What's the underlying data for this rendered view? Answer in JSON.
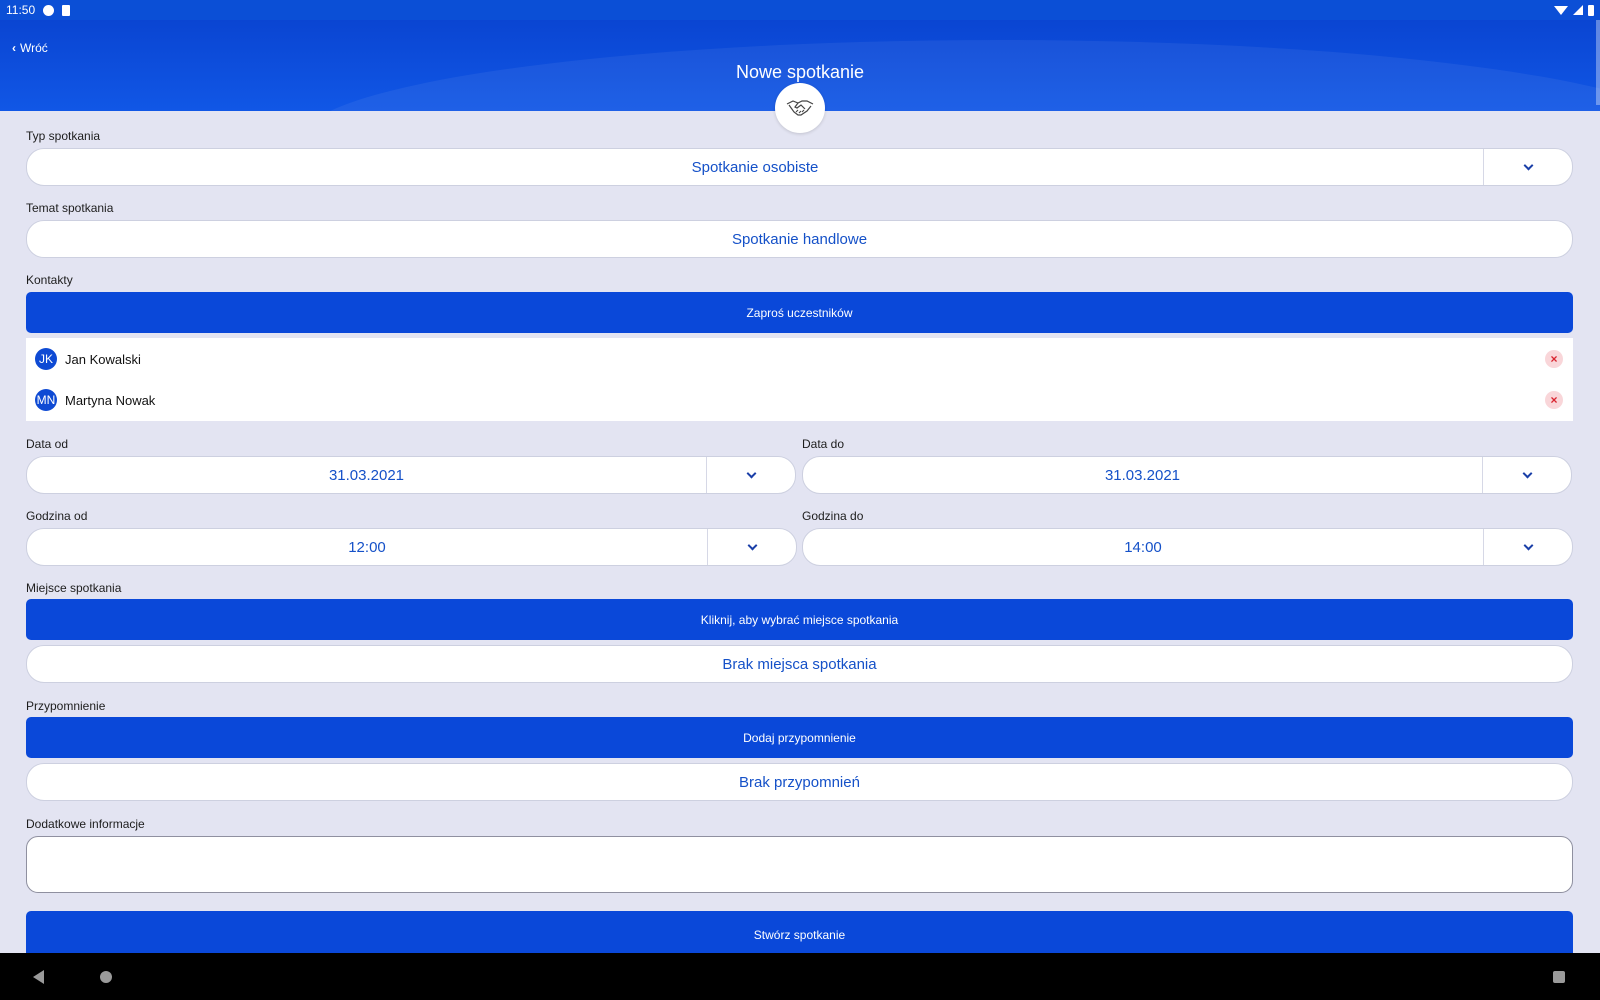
{
  "status_bar": {
    "time": "11:50"
  },
  "header": {
    "back_label": "Wróć",
    "title": "Nowe spotkanie",
    "badge_icon": "handshake-icon"
  },
  "form": {
    "meeting_type": {
      "label": "Typ spotkania",
      "value": "Spotkanie osobiste"
    },
    "meeting_topic": {
      "label": "Temat spotkania",
      "value": "Spotkanie handlowe"
    },
    "contacts": {
      "label": "Kontakty",
      "invite_button": "Zaproś uczestników",
      "items": [
        {
          "initials": "JK",
          "name": "Jan Kowalski"
        },
        {
          "initials": "MN",
          "name": "Martyna Nowak"
        }
      ]
    },
    "date_from": {
      "label": "Data od",
      "value": "31.03.2021"
    },
    "date_to": {
      "label": "Data do",
      "value": "31.03.2021"
    },
    "time_from": {
      "label": "Godzina od",
      "value": "12:00"
    },
    "time_to": {
      "label": "Godzina do",
      "value": "14:00"
    },
    "location": {
      "label": "Miejsce spotkania",
      "button": "Kliknij, aby wybrać miejsce spotkania",
      "value": "Brak miejsca spotkania"
    },
    "reminder": {
      "label": "Przypomnienie",
      "button": "Dodaj przypomnienie",
      "value": "Brak przypomnień"
    },
    "additional_info": {
      "label": "Dodatkowe informacje",
      "value": ""
    },
    "submit_label": "Stwórz spotkanie"
  },
  "colors": {
    "primary": "#0a48d9",
    "background": "#e3e4f2",
    "value_text": "#1551c8",
    "remove_bg": "#f9d6d9",
    "remove_fg": "#d9242f"
  }
}
